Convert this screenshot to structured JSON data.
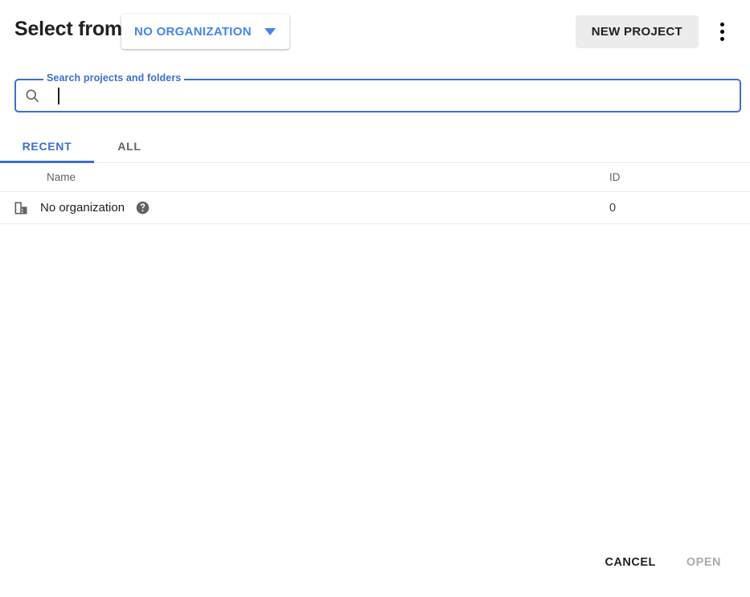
{
  "header": {
    "title": "Select from",
    "org_selector": {
      "label": "NO ORGANIZATION",
      "caret_icon": "chevron-down-icon"
    },
    "new_project_label": "NEW PROJECT",
    "overflow_icon": "more-vert-icon"
  },
  "search": {
    "label": "Search projects and folders",
    "value": "",
    "placeholder": "",
    "icon": "search-icon"
  },
  "tabs": [
    {
      "label": "RECENT",
      "active": true
    },
    {
      "label": "ALL",
      "active": false
    }
  ],
  "table": {
    "columns": [
      {
        "key": "name",
        "label": "Name"
      },
      {
        "key": "id",
        "label": "ID"
      }
    ],
    "rows": [
      {
        "icon": "organization-building-icon",
        "name": "No organization",
        "help_icon": "help-filled-icon",
        "id": "0"
      }
    ]
  },
  "footer": {
    "cancel_label": "CANCEL",
    "open_label": "OPEN",
    "open_disabled": true
  },
  "colors": {
    "accent_blue": "#3c6fd0",
    "link_blue": "#4285f4",
    "text_primary": "#202124",
    "text_secondary": "#5f6368",
    "divider": "#e8eaed",
    "button_bg": "#ececec",
    "disabled_text": "#a8abaf"
  }
}
